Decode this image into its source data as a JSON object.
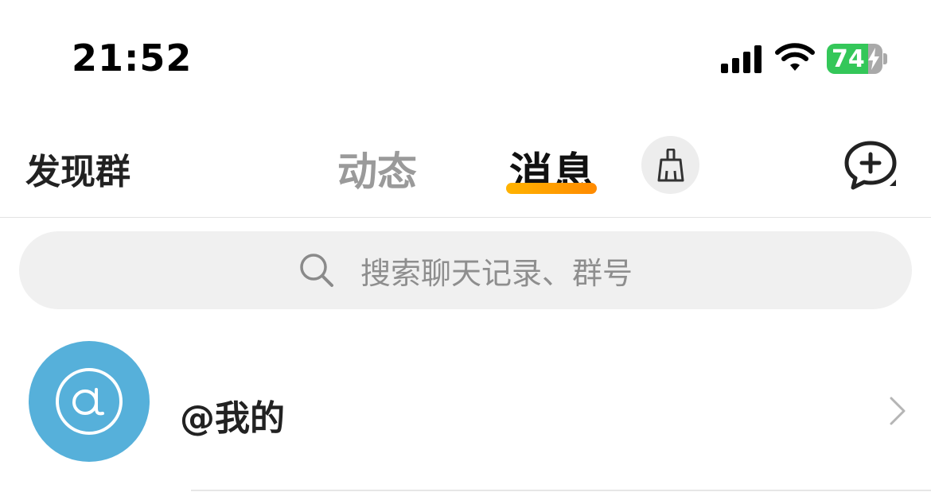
{
  "status_bar": {
    "time": "21:52",
    "battery_level": "74",
    "battery_color": "#34c759",
    "icons": [
      "signal-icon",
      "wifi-icon",
      "battery-icon",
      "charging-bolt-icon"
    ]
  },
  "nav": {
    "left_label": "发现群",
    "tabs": [
      {
        "label": "动态",
        "active": false
      },
      {
        "label": "消息",
        "active": true
      }
    ],
    "accent_color": "#ffa000",
    "clean_icon": "broom-icon",
    "compose_icon": "chat-add-icon"
  },
  "search": {
    "placeholder": "搜索聊天记录、群号",
    "icon": "search-icon"
  },
  "list": {
    "items": [
      {
        "title": "@我的",
        "icon": "at-icon",
        "avatar_color": "#56b0da",
        "trailing_icon": "chevron-right-icon"
      }
    ]
  }
}
